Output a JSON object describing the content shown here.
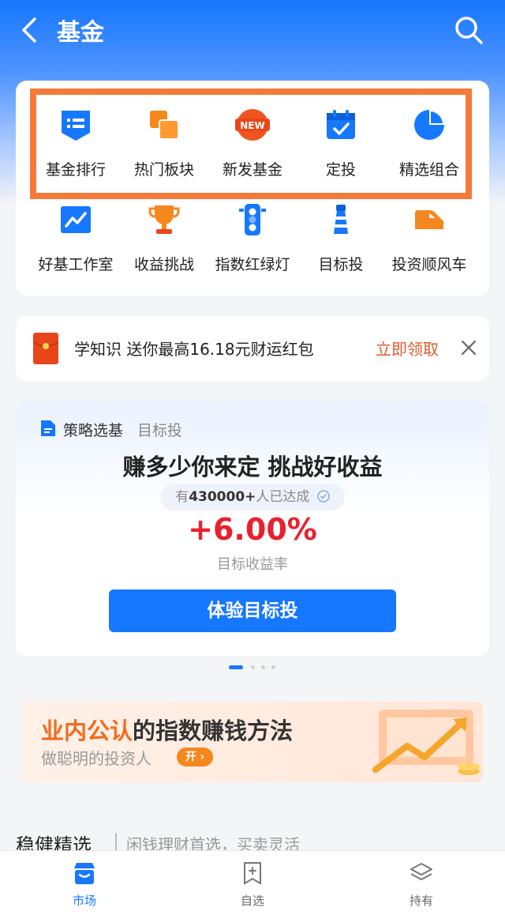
{
  "header": {
    "title": "基金",
    "back_icon": "chevron-left-icon",
    "search_icon": "search-icon"
  },
  "grid": {
    "row1": [
      {
        "label": "基金排行",
        "icon": "list-icon"
      },
      {
        "label": "热门板块",
        "icon": "stacked-squares-icon"
      },
      {
        "label": "新发基金",
        "icon": "new-badge-icon",
        "badge": "NEW"
      },
      {
        "label": "定投",
        "icon": "calendar-check-icon"
      },
      {
        "label": "精选组合",
        "icon": "pie-chart-icon"
      }
    ],
    "row2": [
      {
        "label": "好基工作室",
        "icon": "trend-chart-icon"
      },
      {
        "label": "收益挑战",
        "icon": "trophy-icon"
      },
      {
        "label": "指数红绿灯",
        "icon": "traffic-light-icon"
      },
      {
        "label": "目标投",
        "icon": "lighthouse-icon"
      },
      {
        "label": "投资顺风车",
        "icon": "car-icon"
      }
    ]
  },
  "banner": {
    "text": "学知识 送你最高16.18元财运红包",
    "action": "立即领取"
  },
  "promo": {
    "tag": "策略选基",
    "subtag": "目标投",
    "title": "赚多少你来定 挑战好收益",
    "pill_prefix": "有",
    "pill_count": "430000+",
    "pill_suffix": "人已达成",
    "rate": "+6.00%",
    "rate_label": "目标收益率",
    "button": "体验目标投"
  },
  "ad": {
    "title_highlight": "业内公认",
    "title_rest": "的指数赚钱方法",
    "subtitle": "做聪明的投资人",
    "open_label": "开"
  },
  "section": {
    "title": "稳健精选",
    "subtitle": "闲钱理财首选，买卖灵活"
  },
  "tabs": [
    {
      "label": "市场",
      "icon": "store-icon",
      "active": true
    },
    {
      "label": "自选",
      "icon": "bookmark-add-icon",
      "active": false
    },
    {
      "label": "持有",
      "icon": "layers-icon",
      "active": false
    }
  ],
  "colors": {
    "primary": "#1677ff",
    "orange": "#f57a3a",
    "red": "#e8212f"
  }
}
